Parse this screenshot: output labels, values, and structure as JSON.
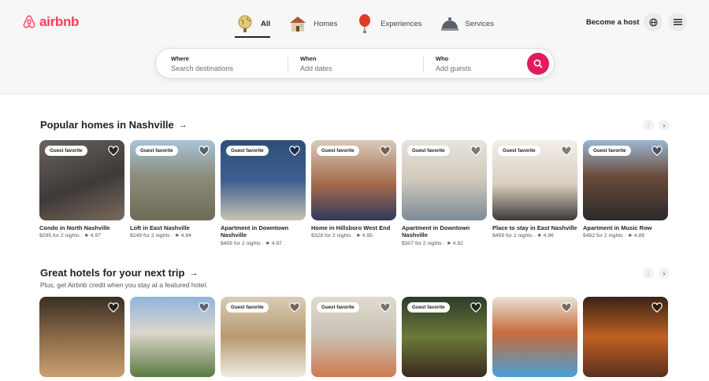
{
  "brand": {
    "name": "airbnb",
    "color": "#ff385c"
  },
  "tabs": [
    {
      "label": "All",
      "icon": "globe-icon",
      "active": true
    },
    {
      "label": "Homes",
      "icon": "house-icon",
      "active": false
    },
    {
      "label": "Experiences",
      "icon": "balloon-icon",
      "active": false
    },
    {
      "label": "Services",
      "icon": "bell-icon",
      "active": false
    }
  ],
  "header": {
    "become_host": "Become a host"
  },
  "search": {
    "where_label": "Where",
    "where_placeholder": "Search destinations",
    "when_label": "When",
    "when_placeholder": "Add dates",
    "who_label": "Who",
    "who_placeholder": "Add guests",
    "button_color": "#e31c5f"
  },
  "section1": {
    "title": "Popular homes in Nashville",
    "cards": [
      {
        "badge": "Guest favorite",
        "title": "Condo in North Nashville",
        "meta": "$295 for 2 nights · ★ 4.97",
        "bg": "linear-gradient(160deg,#6b6460 0%,#3e3a38 55%,#7a6a5c 100%)"
      },
      {
        "badge": "Guest favorite",
        "title": "Loft in East Nashville",
        "meta": "$249 for 2 nights · ★ 4.94",
        "bg": "linear-gradient(180deg,#a9c4d8 0%,#8b8d7a 45%,#6e6a58 100%)"
      },
      {
        "badge": "Guest favorite",
        "title": "Apartment in Downtown Nashville",
        "meta": "$405 for 2 nights · ★ 4.97",
        "bg": "linear-gradient(180deg,#2f4f7a 0%,#3d5f8f 50%,#c9c2b4 100%)"
      },
      {
        "badge": "Guest favorite",
        "title": "Home in Hillsboro West End",
        "meta": "$328 for 2 nights · ★ 4.95",
        "bg": "linear-gradient(180deg,#d8cbb8 0%,#a56a4a 55%,#2f3a5c 100%)"
      },
      {
        "badge": "Guest favorite",
        "title": "Apartment in Downtown Nashville",
        "meta": "$307 for 2 nights · ★ 4.92",
        "bg": "linear-gradient(180deg,#e8e4dc 0%,#cfc8bb 50%,#7d8c96 100%)"
      },
      {
        "badge": "Guest favorite",
        "title": "Place to stay in East Nashville",
        "meta": "$499 for 2 nights · ★ 4.96",
        "bg": "linear-gradient(180deg,#f2efe8 0%,#d9cfc0 55%,#3b3b3b 100%)"
      },
      {
        "badge": "Guest favorite",
        "title": "Apartment in Music Row",
        "meta": "$482 for 2 nights · ★ 4.89",
        "bg": "linear-gradient(180deg,#9bb7d4 0%,#6a4a3a 45%,#2b2b2b 100%)"
      }
    ]
  },
  "section2": {
    "title": "Great hotels for your next trip",
    "subtitle": "Plus, get Airbnb credit when you stay at a featured hotel.",
    "cards": [
      {
        "badge": "",
        "bg": "linear-gradient(180deg,#3a2e24 0%,#8a6a48 50%,#c9a070 100%)"
      },
      {
        "badge": "",
        "bg": "linear-gradient(180deg,#8fb4dc 0%,#dcd6cc 45%,#5a7a40 100%)"
      },
      {
        "badge": "Guest favorite",
        "bg": "linear-gradient(180deg,#d9cdb8 0%,#b89a70 50%,#f0ebe2 100%)"
      },
      {
        "badge": "Guest favorite",
        "bg": "linear-gradient(180deg,#e0dbd2 0%,#c8bfb0 50%,#d07a50 100%)"
      },
      {
        "badge": "Guest favorite",
        "bg": "linear-gradient(180deg,#2e3a2a 0%,#6b7a3a 50%,#3a2a1e 100%)"
      },
      {
        "badge": "",
        "bg": "linear-gradient(180deg,#e8e2d8 0%,#c76a3a 45%,#4aa0d8 100%)"
      },
      {
        "badge": "",
        "bg": "linear-gradient(180deg,#3a2418 0%,#c06020 50%,#5a3020 100%)"
      }
    ]
  }
}
